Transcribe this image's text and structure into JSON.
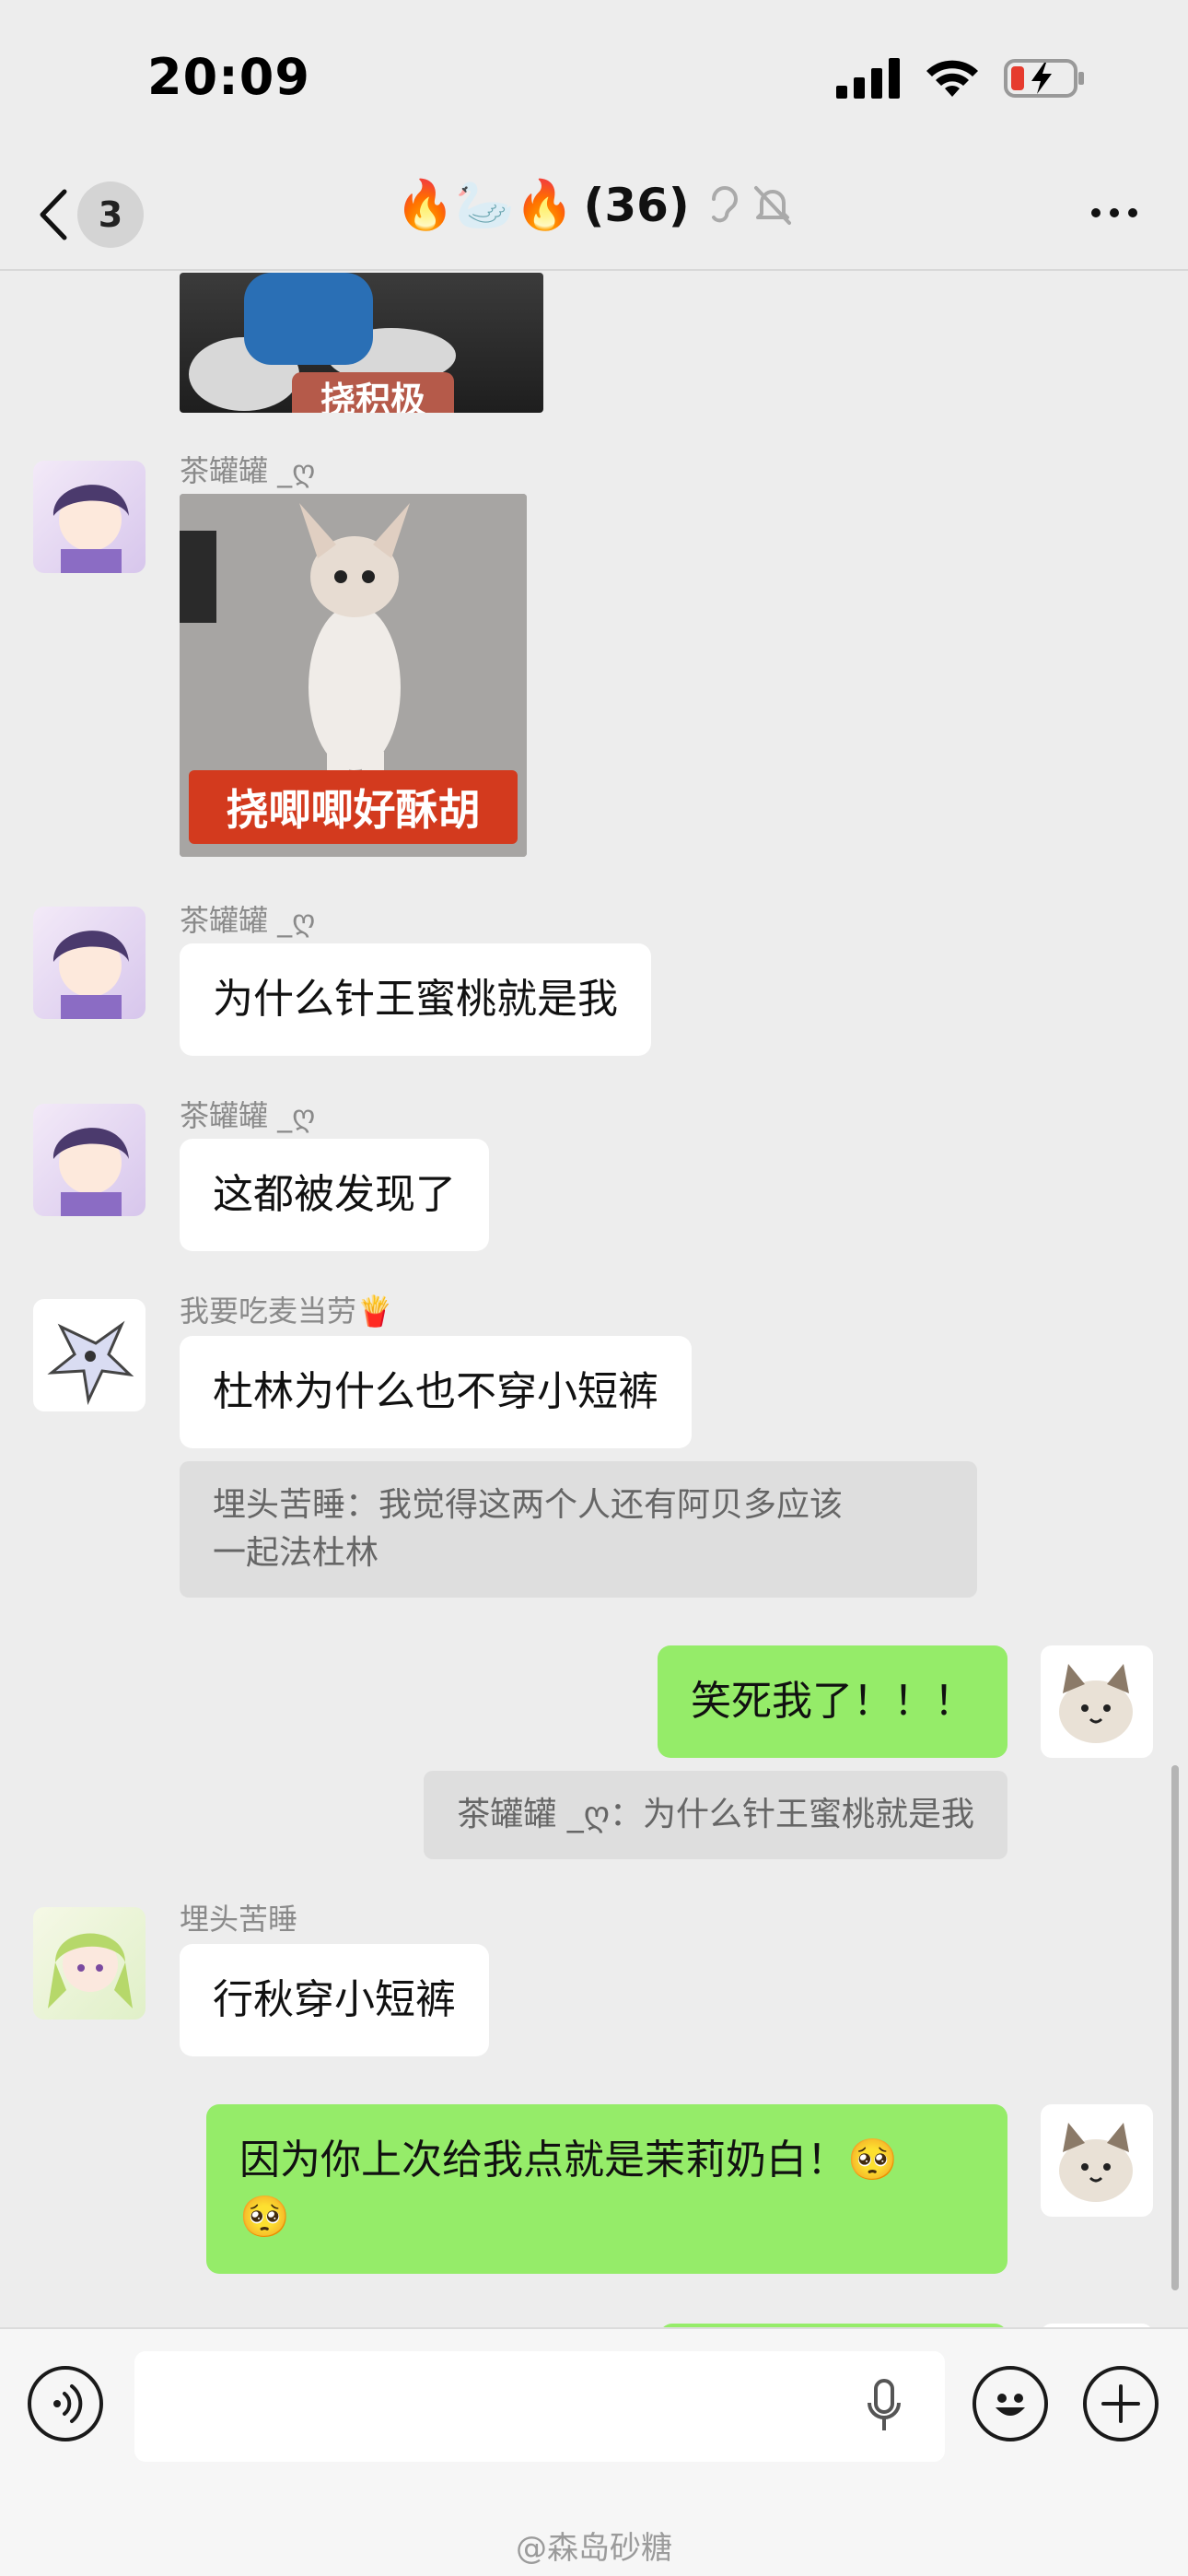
{
  "status": {
    "time": "20:09"
  },
  "nav": {
    "unread": "3",
    "title_emoji": "🔥🦢🔥",
    "title_count": "(36)"
  },
  "chat": {
    "msg1": {
      "sender": "茶罐罐 _ღ",
      "sticker_caption": "挠唧唧好酥胡"
    },
    "partial_sticker_caption": "挠积极",
    "msg2": {
      "sender": "茶罐罐 _ღ",
      "text": "为什么针王蜜桃就是我"
    },
    "msg3": {
      "sender": "茶罐罐 _ღ",
      "text": "这都被发现了"
    },
    "msg4": {
      "sender": "我要吃麦当劳🍟",
      "text": "杜林为什么也不穿小短裤",
      "quote_line1": "埋头苦睡：我觉得这两个人还有阿贝多应该",
      "quote_line2": "一起法杜林"
    },
    "msg5": {
      "text": "笑死我了！！！",
      "quote": "茶罐罐 _ღ：为什么针王蜜桃就是我"
    },
    "msg6": {
      "sender": "埋头苦睡",
      "text": "行秋穿小短裤"
    },
    "msg7": {
      "line1": "因为你上次给我点就是茉莉奶白！🥺",
      "line2": "🥺"
    }
  },
  "watermark": "@森岛砂糖",
  "colors": {
    "bubble_green": "#95ec69",
    "background": "#ededed",
    "battery_red": "#e63b2e"
  }
}
